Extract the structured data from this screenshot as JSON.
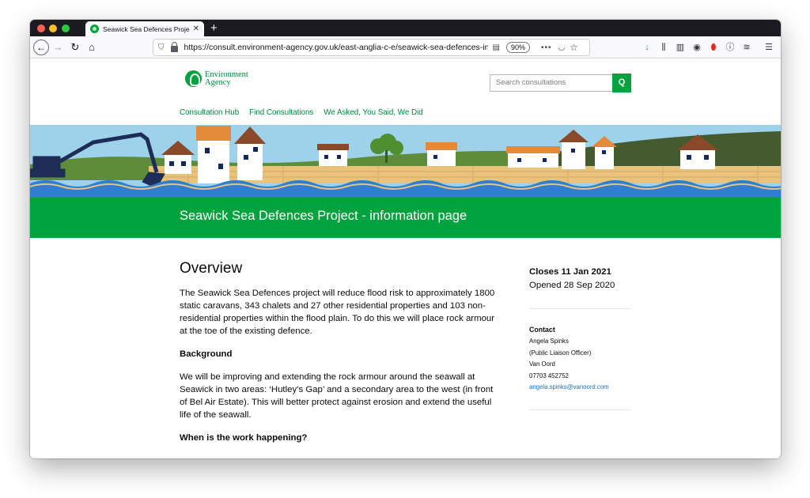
{
  "browser": {
    "tab_title": "Seawick Sea Defences Project",
    "tab_close": "✕",
    "new_tab": "+",
    "url": "https://consult.environment-agency.gov.uk/east-anglia-c-e/seawick-sea-defences-informa",
    "zoom": "90%",
    "url_actions": "•••",
    "icons": [
      "back-arrow-icon",
      "forward-arrow-icon",
      "reload-icon",
      "home-icon",
      "shield-icon",
      "lock-icon",
      "reader-view-icon",
      "pocket-icon",
      "star-icon",
      "download-icon",
      "library-icon",
      "sidebar-icon",
      "tracker-icon",
      "opera-icon",
      "info-icon",
      "layers-icon",
      "menu-icon"
    ]
  },
  "site": {
    "logo_line1": "Environment",
    "logo_line2": "Agency",
    "search_placeholder": "Search consultations",
    "search_button": "Q",
    "nav": [
      "Consultation Hub",
      "Find Consultations",
      "We Asked, You Said, We Did"
    ],
    "brand_color": "#00a33d"
  },
  "page": {
    "title": "Seawick Sea Defences Project - information page",
    "overview_heading": "Overview",
    "overview_text": "The Seawick Sea Defences project will reduce flood risk to approximately 1800 static caravans, 343 chalets and 27 other residential properties and 103 non-residential properties within the flood plain. To do this we will place rock armour at the toe of the existing defence.",
    "background_heading": "Background",
    "background_text": "We will be improving and extending the rock armour around the seawall at Seawick in two areas: ‘Hutley’s Gap’ and a secondary area to the west (in front of Bel Air Estate). This will better protect against erosion and extend the useful life of the seawall.",
    "when_heading": "When is the work happening?"
  },
  "aside": {
    "closes": "Closes 11 Jan 2021",
    "opened": "Opened 28 Sep 2020",
    "contact_label": "Contact",
    "contact_name": "Angela Spinks",
    "contact_role": "(Public Liaison Officer)",
    "contact_org": "Van Oord",
    "contact_phone": "07703 452752",
    "contact_email": "angela.spinks@vanoord.com"
  }
}
